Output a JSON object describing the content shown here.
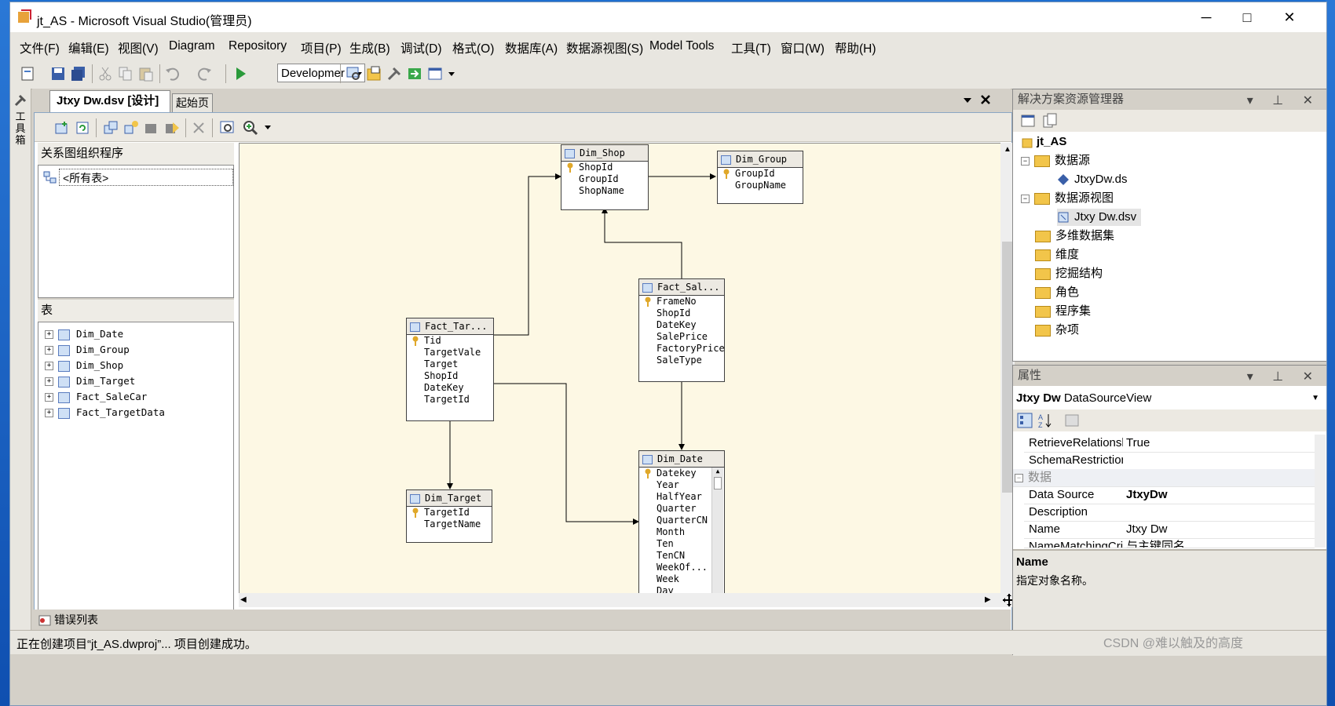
{
  "window": {
    "title": "jt_AS - Microsoft Visual Studio(管理员)",
    "minimize": "─",
    "maximize": "□",
    "close": "✕"
  },
  "menu": [
    "文件(F)",
    "编辑(E)",
    "视图(V)",
    "Diagram",
    "Repository",
    "项目(P)",
    "生成(B)",
    "调试(D)",
    "格式(O)",
    "数据库(A)",
    "数据源视图(S)",
    "Model Tools",
    "工具(T)",
    "窗口(W)",
    "帮助(H)"
  ],
  "toolbar": {
    "config_value": "Developmer"
  },
  "toolbox_label": "工具箱",
  "tabs": {
    "active": "Jtxy Dw.dsv [设计]",
    "start": "起始页"
  },
  "organizer": {
    "header": "关系图组织程序",
    "item": "<所有表>"
  },
  "tables_pane": {
    "header": "表",
    "items": [
      "Dim_Date",
      "Dim_Group",
      "Dim_Shop",
      "Dim_Target",
      "Fact_SaleCar",
      "Fact_TargetData"
    ]
  },
  "diagram": {
    "entities": [
      {
        "name": "Dim_Shop",
        "columns": [
          "ShopId",
          "GroupId",
          "ShopName"
        ]
      },
      {
        "name": "Dim_Group",
        "columns": [
          "GroupId",
          "GroupName"
        ]
      },
      {
        "name": "Fact_Sal...",
        "columns": [
          "FrameNo",
          "ShopId",
          "DateKey",
          "SalePrice",
          "FactoryPrice",
          "SaleType"
        ]
      },
      {
        "name": "Fact_Tar...",
        "columns": [
          "Tid",
          "TargetVale",
          "Target",
          "ShopId",
          "DateKey",
          "TargetId"
        ]
      },
      {
        "name": "Dim_Target",
        "columns": [
          "TargetId",
          "TargetName"
        ]
      },
      {
        "name": "Dim_Date",
        "columns": [
          "Datekey",
          "Year",
          "HalfYear",
          "Quarter",
          "QuarterCN",
          "Month",
          "Ten",
          "TenCN",
          "WeekOf...",
          "Week",
          "Day"
        ]
      }
    ]
  },
  "solution_explorer": {
    "title": "解决方案资源管理器",
    "root": "jt_AS",
    "items": [
      "数据源",
      "JtxyDw.ds",
      "数据源视图",
      "Jtxy Dw.dsv",
      "多维数据集",
      "维度",
      "挖掘结构",
      "角色",
      "程序集",
      "杂项"
    ]
  },
  "properties": {
    "title": "属性",
    "object": "Jtxy Dw",
    "object_type": "DataSourceView",
    "rows": [
      {
        "name": "RetrieveRelationsh",
        "value": "True"
      },
      {
        "name": "SchemaRestriction",
        "value": ""
      },
      {
        "name": "数据",
        "value": ""
      },
      {
        "name": "Data Source",
        "value": "JtxyDw"
      },
      {
        "name": "Description",
        "value": ""
      },
      {
        "name": "Name",
        "value": "Jtxy Dw"
      },
      {
        "name": "NameMatchingCri",
        "value": "与主键同名"
      }
    ],
    "desc_title": "Name",
    "desc_text": "指定对象名称。"
  },
  "bottom": {
    "error_list": "错误列表",
    "status": "正在创建项目“jt_AS.dwproj”... 项目创建成功。",
    "watermark": "CSDN @难以触及的高度"
  }
}
